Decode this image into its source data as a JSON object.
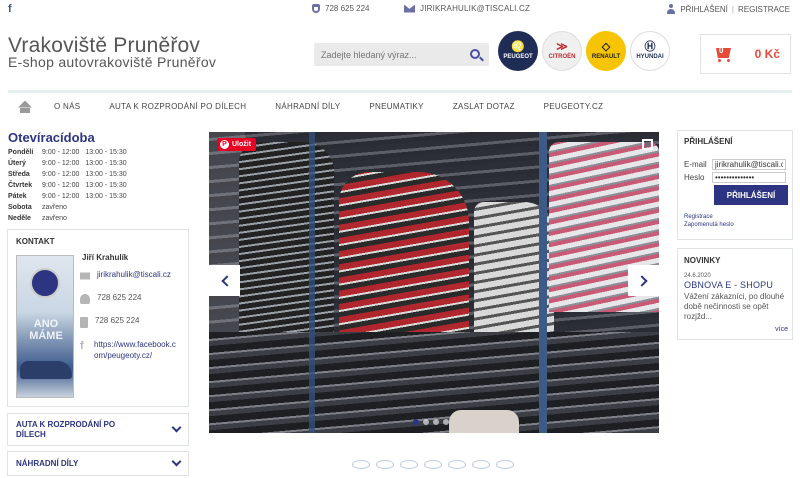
{
  "topbar": {
    "facebook_icon": "facebook-icon",
    "phone": "728 625 224",
    "email": "jirikrahulik@tiscali.cz",
    "login": "Přihlášení",
    "separator": "|",
    "register": "Registrace"
  },
  "header": {
    "title": "Vrakoviště Pruněřov",
    "subtitle": "E-shop autovrakoviště Pruněřov"
  },
  "search": {
    "placeholder": "Zadejte hledaný výraz..."
  },
  "brands": [
    {
      "name": "Peugeot",
      "label": "PEUGEOT",
      "color": "#1e2c56"
    },
    {
      "name": "Citroën",
      "label": "CITROËN",
      "color": "#c0282d"
    },
    {
      "name": "Renault",
      "label": "RENAULT",
      "color": "#f6c400"
    },
    {
      "name": "Hyundai",
      "label": "HYUNDAI",
      "color": "#1e2c56"
    }
  ],
  "cart": {
    "count": "0",
    "total": "0 Kč",
    "color": "#e84a3a"
  },
  "nav": {
    "home_icon": "home-icon",
    "items": [
      "O nás",
      "Auta k rozprodání po dílech",
      "Náhradní díly",
      "Pneumatiky",
      "Zaslat dotaz",
      "peugeoty.cz"
    ]
  },
  "hours": {
    "title": "Otevíracídoba",
    "rows": [
      {
        "day": "Pondělí",
        "am": "9:00 - 12:00",
        "pm": "13:00 - 15:30"
      },
      {
        "day": "Úterý",
        "am": "9:00 - 12:00",
        "pm": "13:00 - 15:30"
      },
      {
        "day": "Středa",
        "am": "9:00 - 12:00",
        "pm": "13:00 - 15:30"
      },
      {
        "day": "Čtvrtek",
        "am": "9:00 - 12:00",
        "pm": "13:00 - 15:30"
      },
      {
        "day": "Pátek",
        "am": "9:00 - 12:00",
        "pm": "13:00 - 15:30"
      },
      {
        "day": "Sobota",
        "am": "zavřeno",
        "pm": ""
      },
      {
        "day": "Neděle",
        "am": "zavřeno",
        "pm": ""
      }
    ]
  },
  "contact": {
    "heading": "Kontakt",
    "image_text": "ANO MÁME",
    "name": "Jiří Krahulík",
    "email": "jirikrahulik@tiscali.cz",
    "phone": "728 625 224",
    "mobile": "728 625 224",
    "facebook": "https://www.facebook.com/peugeoty.cz/"
  },
  "accordion": [
    {
      "label": "Auta k rozprodání po dílech"
    },
    {
      "label": "Náhradní díly"
    }
  ],
  "slider": {
    "pinterest_label": "Uložit",
    "slides": 4,
    "active_slide": 1,
    "accent": "#2d3583"
  },
  "login": {
    "heading": "Přihlášení",
    "email_label": "E-mail",
    "email_value": "jirikrahulik@tiscali.c",
    "password_label": "Heslo",
    "password_value": "••••••••••••••",
    "submit": "Přihlášení",
    "register_link": "Registrace",
    "forgot_link": "Zapomenutá heslo"
  },
  "news": {
    "heading": "Novinky",
    "date": "24.6.2020",
    "title": "Obnova e - shopu",
    "body": "Vážení zákazníci, po dlouhé době nečinnosti se opět rozjžd...",
    "more": "více"
  }
}
